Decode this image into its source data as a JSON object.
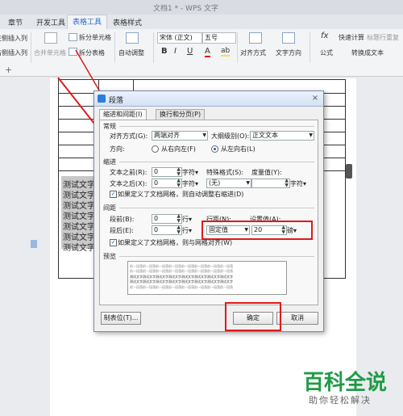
{
  "window": {
    "title": "文档1 * - WPS 文字"
  },
  "tabs": [
    {
      "label": "章节"
    },
    {
      "label": "开发工具"
    },
    {
      "label": "表格工具"
    },
    {
      "label": "表格样式"
    }
  ],
  "ribbon": {
    "insert_left_col": "在左侧插入列",
    "insert_right_col": "在右侧插入列",
    "merge_cells": "合并单元格",
    "split_cells": "拆分单元格",
    "split_table": "拆分表格",
    "auto_adjust": "自动调整",
    "font_name": "宋体 (正文)",
    "font_size": "五号",
    "bold": "B",
    "italic": "I",
    "underline": "U",
    "font_color": "A",
    "highlight": "ab",
    "align": "对齐方式",
    "text_direction": "文字方向",
    "fx": "fx",
    "formula": "公式",
    "quick_calc": "快速计算",
    "header_repeat": "标题行重复",
    "convert_text": "转换成文本",
    "add_row": "+"
  },
  "document": {
    "cell_text": "测试文字测",
    "cell_rows": 7
  },
  "dialog": {
    "title": "段落",
    "close": "×",
    "tabs": [
      "缩进和间距(I)",
      "换行和分页(P)"
    ],
    "general": {
      "header": "常规",
      "align_label": "对齐方式(G):",
      "align_value": "两端对齐",
      "outline_label": "大纲级别(O):",
      "outline_value": "正文文本",
      "direction_label": "方向:",
      "rtl_label": "从右向左(F)",
      "ltr_label": "从左向右(L)"
    },
    "indent": {
      "header": "缩进",
      "before_label": "文本之前(R):",
      "before_value": "0",
      "after_label": "文本之后(X):",
      "after_value": "0",
      "unit": "字符▾",
      "special_label": "特殊格式(S):",
      "special_value": "(无)",
      "measure_label": "度量值(Y):",
      "measure_value": "",
      "measure_unit": "字符▾",
      "grid_check": "如果定义了文档网格，则自动调整右缩进(D)"
    },
    "spacing": {
      "header": "间距",
      "before_label": "段前(B):",
      "before_value": "0",
      "after_label": "段后(E):",
      "after_value": "0",
      "unit": "行▾",
      "line_label": "行距(N):",
      "line_value": "固定值",
      "setting_label": "设置值(A):",
      "setting_value": "20",
      "setting_unit": "磅▾",
      "grid_check": "如果定义了文档网格，则与网格对齐(W)"
    },
    "preview": {
      "header": "预览",
      "sample_prev": "前一段落前一段落前一段落前一段落前一段落前一段落前一段落前一段落",
      "sample_text": "测试文字测试文字测试文字测试文字测试文字测试文字测试文字测试文字"
    },
    "tabs_button": "制表位(T)...",
    "ok_button": "确定",
    "cancel_button": "取消"
  },
  "watermark": {
    "line1": "百科全说",
    "line2": "助你轻松解决"
  },
  "colors": {
    "highlight_red": "#e01a1a",
    "wps_blue": "#2b6cc4",
    "watermark_green": "#1f9b46"
  }
}
